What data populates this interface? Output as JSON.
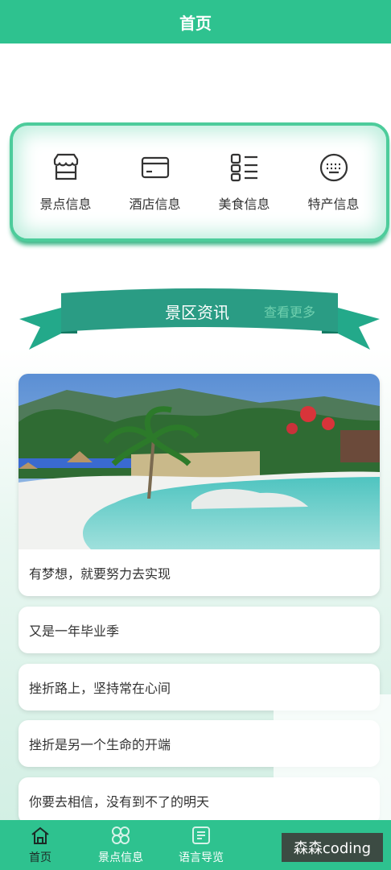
{
  "header": {
    "title": "首页"
  },
  "quick_links": [
    {
      "label": "景点信息",
      "icon": "store-icon"
    },
    {
      "label": "酒店信息",
      "icon": "card-icon"
    },
    {
      "label": "美食信息",
      "icon": "list-grid-icon"
    },
    {
      "label": "特产信息",
      "icon": "keyboard-icon"
    }
  ],
  "section": {
    "title": "景区资讯",
    "more": "查看更多"
  },
  "news": [
    "有梦想，就要努力去实现",
    "又是一年毕业季",
    "挫折路上，坚持常在心间",
    "挫折是另一个生命的开端",
    "你要去相信，没有到不了的明天"
  ],
  "tabs": [
    {
      "label": "首页",
      "icon": "home-icon",
      "active": true
    },
    {
      "label": "景点信息",
      "icon": "grid-icon",
      "active": false
    },
    {
      "label": "语言导览",
      "icon": "guide-icon",
      "active": false
    }
  ],
  "watermark": "森森coding",
  "colors": {
    "primary": "#2ec28f",
    "ribbon": "#1fa88a"
  }
}
